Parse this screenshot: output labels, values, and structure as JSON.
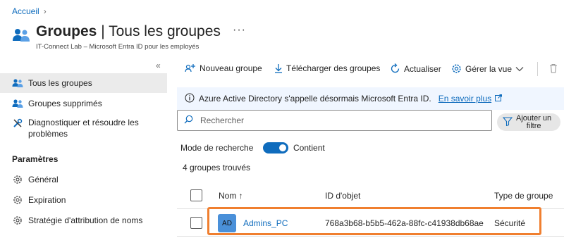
{
  "breadcrumb": {
    "home": "Accueil"
  },
  "header": {
    "title_bold": "Groupes",
    "title_sep": " | ",
    "title_rest": "Tous les groupes",
    "more": "···",
    "subtitle": "IT-Connect Lab – Microsoft Entra ID pour les employés"
  },
  "sidebar": {
    "collapse": "«",
    "items": [
      {
        "label": "Tous les groupes",
        "icon": "groups-icon"
      },
      {
        "label": "Groupes supprimés",
        "icon": "groups-icon"
      },
      {
        "label": "Diagnostiquer et résoudre les",
        "label2": "problèmes",
        "icon": "wrench-icon"
      }
    ],
    "section": "Paramètres",
    "settings": [
      {
        "label": "Général",
        "icon": "gear-icon"
      },
      {
        "label": "Expiration",
        "icon": "gear-icon"
      },
      {
        "label": "Stratégie d'attribution de noms",
        "icon": "gear-icon"
      }
    ]
  },
  "toolbar": {
    "new_group": "Nouveau groupe",
    "download": "Télécharger des groupes",
    "refresh": "Actualiser",
    "manage_view": "Gérer la vue"
  },
  "info": {
    "message": "Azure Active Directory s'appelle désormais Microsoft Entra ID.",
    "link": "En savoir plus"
  },
  "search": {
    "placeholder": "Rechercher"
  },
  "filter": {
    "line1": "Ajouter un",
    "line2": "filtre"
  },
  "search_mode": {
    "label": "Mode de recherche",
    "value": "Contient",
    "enabled": true
  },
  "result_count": "4 groupes trouvés",
  "table": {
    "columns": {
      "name": "Nom ↑",
      "object_id": "ID d'objet",
      "type": "Type de groupe"
    },
    "rows": [
      {
        "initials": "AD",
        "name": "Admins_PC",
        "object_id": "768a3b68-b5b5-462a-88fc-c41938db68ae",
        "type": "Sécurité"
      }
    ]
  },
  "colors": {
    "accent": "#0f6cbd",
    "highlight": "#f07f2f",
    "avatar": "#4a90d9"
  }
}
